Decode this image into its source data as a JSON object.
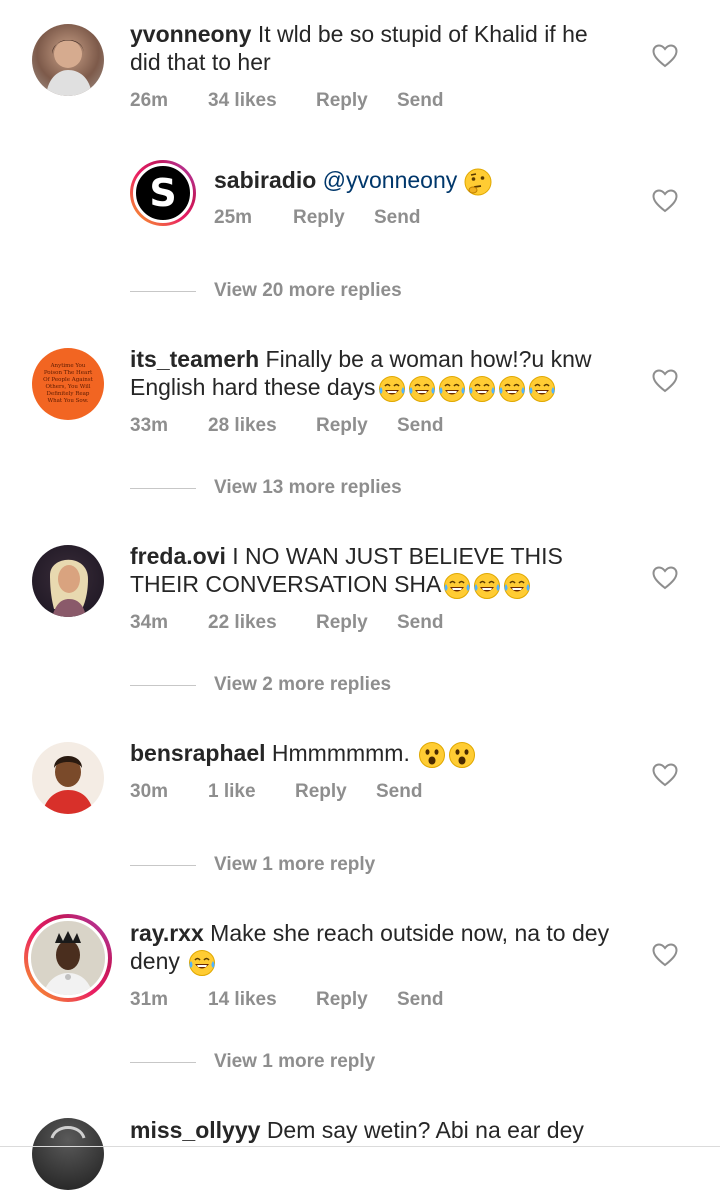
{
  "comments": [
    {
      "username": "yvonneony",
      "text_line1": "It wld be so stupid of Khalid if he",
      "text_line2": "did that to her",
      "time": "26m",
      "likes": "34 likes",
      "reply": "Reply",
      "send": "Send"
    },
    {
      "username": "sabiradio",
      "text": "@yvonneony",
      "avatar_letter": "S",
      "time": "25m",
      "reply": "Reply",
      "send": "Send",
      "view_more": "View 20 more replies"
    },
    {
      "username": "its_teamerh",
      "text_line1": "Finally be a woman how!?u knw",
      "text_line2": "English hard these days",
      "avatar_text": "Anytime You Poison The Heart Of People Against Others, You Will Definitely Reap What You Sow.",
      "time": "33m",
      "likes": "28 likes",
      "reply": "Reply",
      "send": "Send",
      "view_more": "View 13 more replies"
    },
    {
      "username": "freda.ovi",
      "text_line1": "I NO WAN JUST  BELIEVE THIS",
      "text_line2": "THEIR CONVERSATION SHA",
      "time": "34m",
      "likes": "22 likes",
      "reply": "Reply",
      "send": "Send",
      "view_more": "View 2 more replies"
    },
    {
      "username": "bensraphael",
      "text_line1": "Hmmmmmm.",
      "time": "30m",
      "likes": "1 like",
      "reply": "Reply",
      "send": "Send",
      "view_more": "View 1 more reply"
    },
    {
      "username": "ray.rxx",
      "text_line1": "Make she reach outside now, na to dey",
      "text_line2": "deny",
      "time": "31m",
      "likes": "14 likes",
      "reply": "Reply",
      "send": "Send",
      "view_more": "View 1 more reply"
    },
    {
      "username": "miss_ollyyy",
      "text_line1": "Dem say wetin? Abi na ear dey"
    }
  ],
  "colors": {
    "text": "#262626",
    "meta": "#8e8e8e",
    "orange_avatar": "#f26522"
  },
  "icons": [
    "heart-outline-icon",
    "thinking-face-emoji",
    "laughing-crying-emoji",
    "surprised-face-emoji"
  ]
}
